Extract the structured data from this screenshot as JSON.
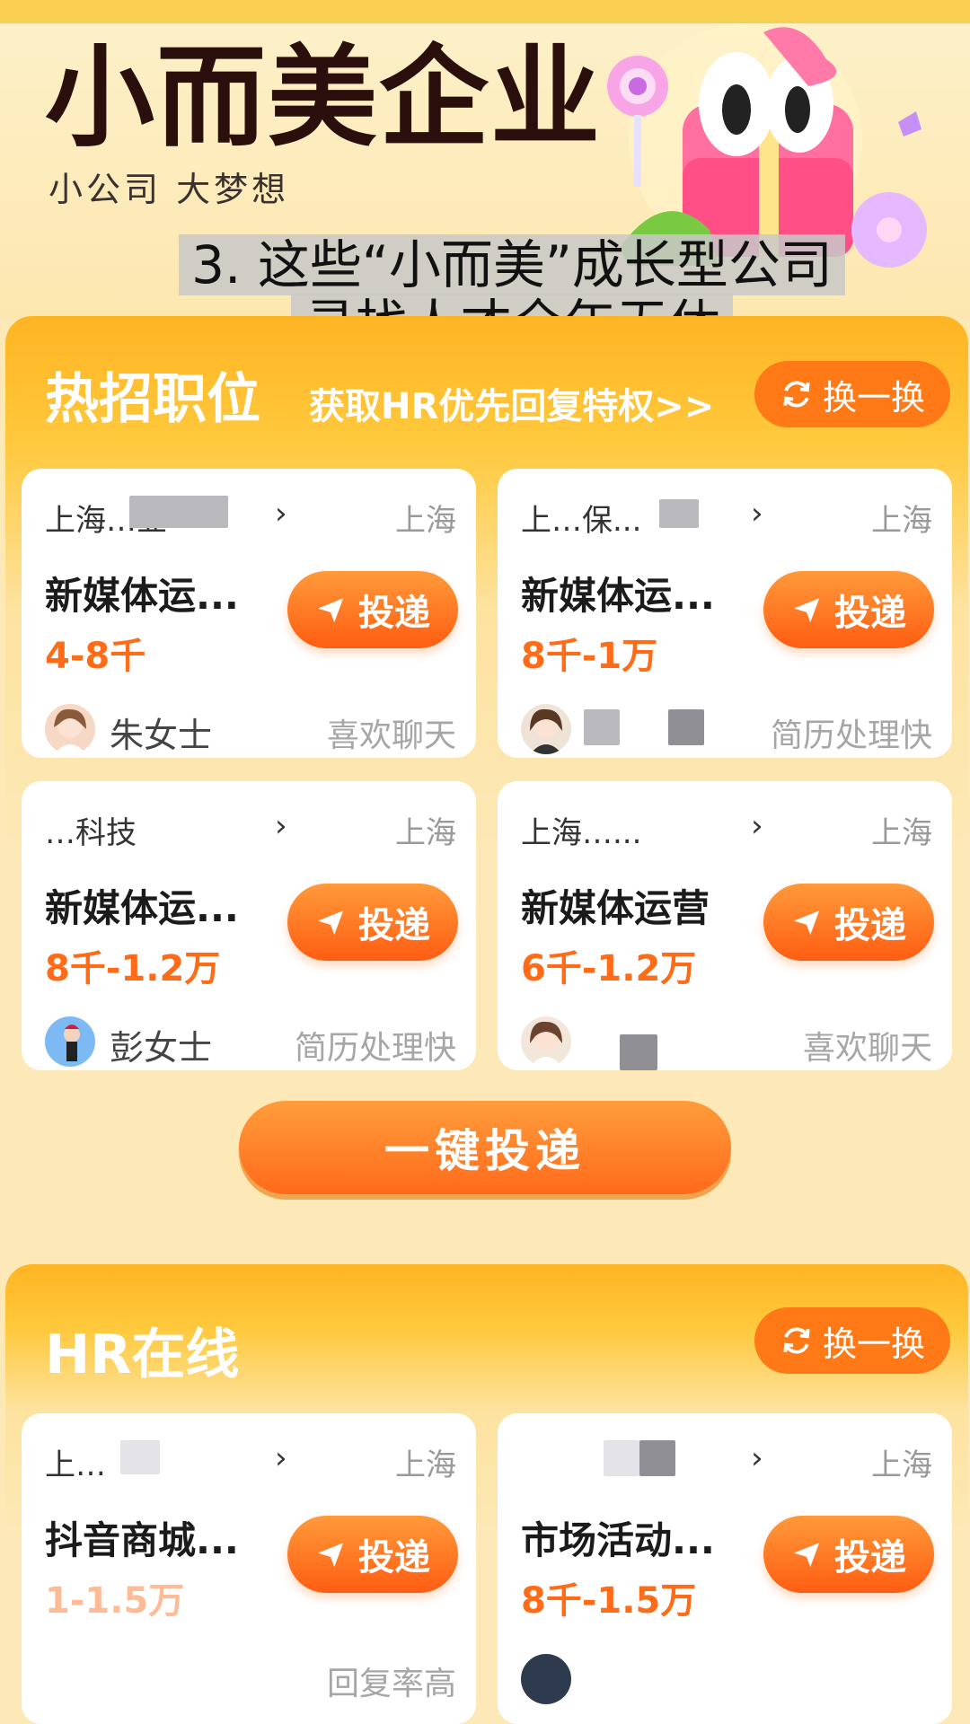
{
  "hero": {
    "title": "小而美企业",
    "subtitle": "小公司 大梦想"
  },
  "caption": {
    "line1": "3. 这些“小而美”成长型公司",
    "line2": "寻找人才全年无休"
  },
  "hot_jobs": {
    "title": "热招职位",
    "promo": "获取HR优先回复特权>>",
    "refresh_label": "换一换",
    "cards": [
      {
        "company": "上海…业",
        "city": "上海",
        "job": "新媒体运...",
        "salary": "4-8千",
        "hr_name": "朱女士",
        "hr_tag": "喜欢聊天",
        "apply_label": "投递"
      },
      {
        "company": "上…保...",
        "city": "上海",
        "job": "新媒体运...",
        "salary": "8千-1万",
        "hr_name": "",
        "hr_tag": "简历处理快",
        "apply_label": "投递"
      },
      {
        "company": "…科技",
        "city": "上海",
        "job": "新媒体运...",
        "salary": "8千-1.2万",
        "hr_name": "彭女士",
        "hr_tag": "简历处理快",
        "apply_label": "投递"
      },
      {
        "company": "上海…...",
        "city": "上海",
        "job": "新媒体运营",
        "salary": "6千-1.2万",
        "hr_name": "",
        "hr_tag": "喜欢聊天",
        "apply_label": "投递"
      }
    ],
    "one_click_label": "一键投递"
  },
  "hr_online": {
    "title": "HR在线",
    "refresh_label": "换一换",
    "cards": [
      {
        "company": "上…",
        "city": "上海",
        "job": "抖音商城...",
        "salary": "1-1.5万",
        "hr_tag": "回复率高",
        "apply_label": "投递"
      },
      {
        "company": "",
        "city": "上海",
        "job": "市场活动...",
        "salary": "8千-1.5万",
        "hr_tag": "",
        "apply_label": "投递"
      }
    ]
  },
  "colors": {
    "accent": "#ff6b16",
    "section_header": "#ffb423",
    "title_dark": "#2a0f0c"
  },
  "icons": [
    "refresh-icon",
    "send-icon",
    "chevron-right-icon",
    "avatar"
  ]
}
